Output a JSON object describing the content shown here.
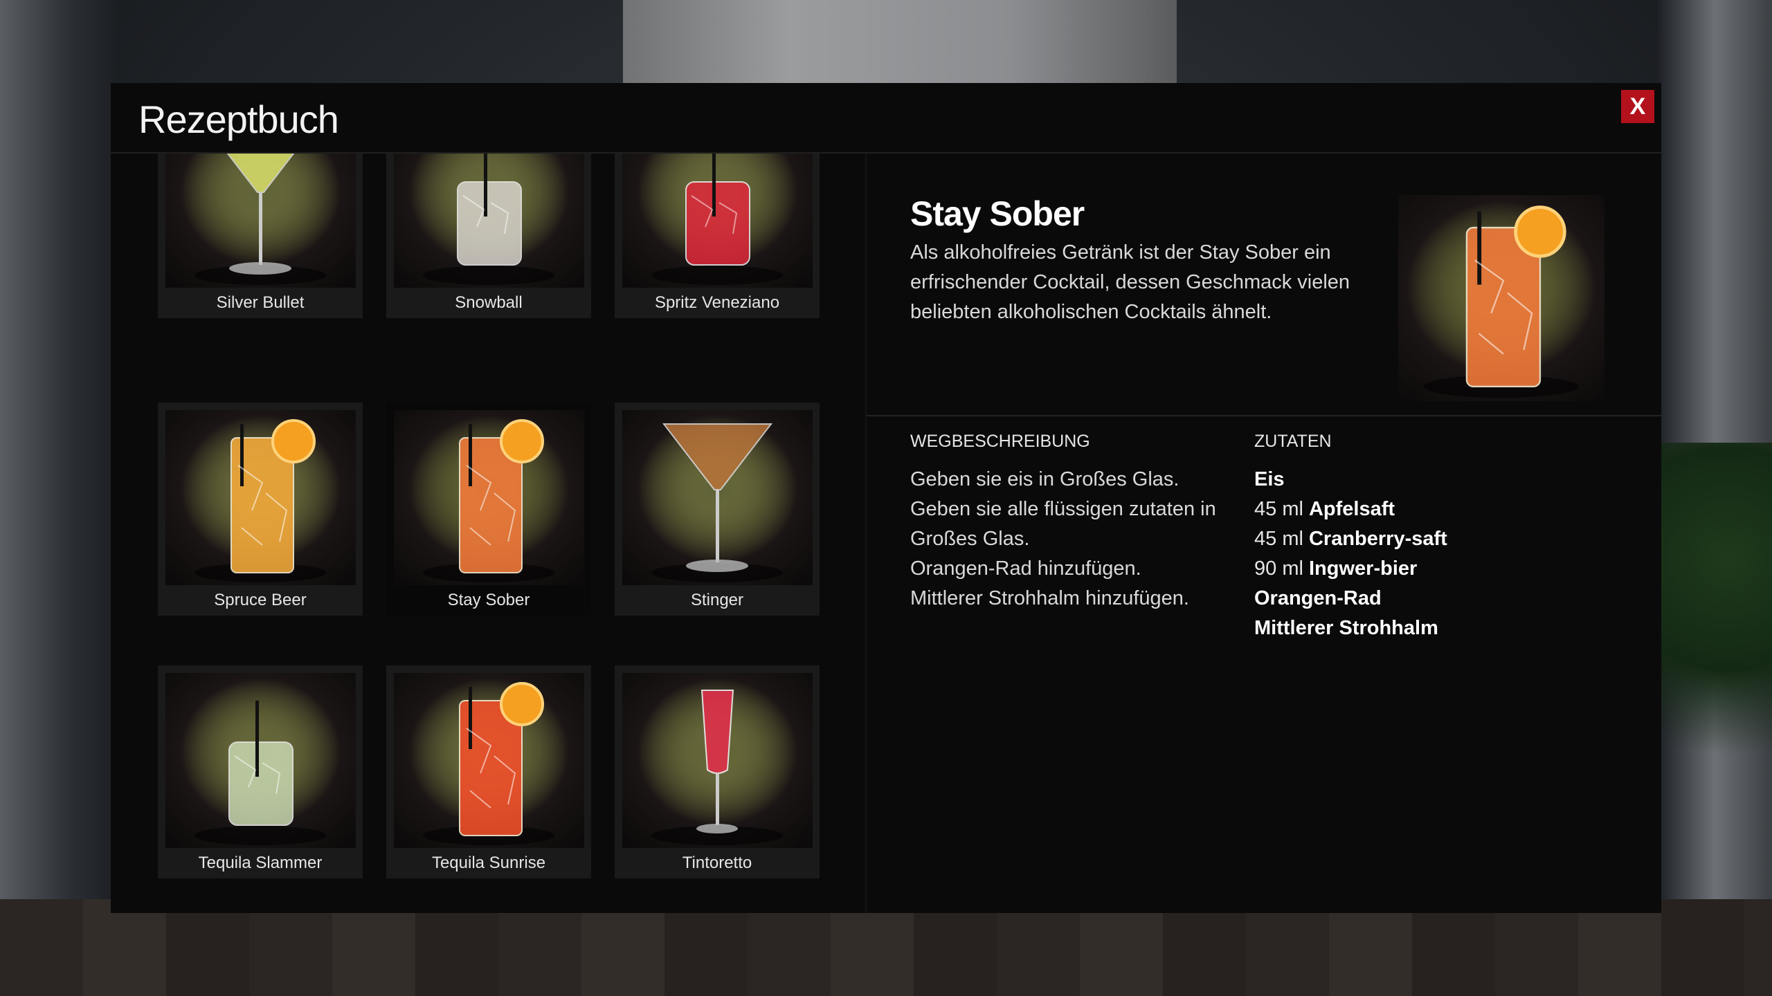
{
  "panel": {
    "title": "Rezeptbuch",
    "close_label": "X"
  },
  "recipes": [
    {
      "name": "Silver Bullet",
      "glass": "martini",
      "color": "#d9e06a"
    },
    {
      "name": "Snowball",
      "glass": "rocks",
      "color": "#d8d4cc"
    },
    {
      "name": "Spritz Veneziano",
      "glass": "rocks",
      "color": "#e0283a"
    },
    {
      "name": "Spruce Beer",
      "glass": "highball",
      "color": "#f0a83a"
    },
    {
      "name": "Stay Sober",
      "glass": "highball",
      "color": "#f07a3a",
      "selected": true
    },
    {
      "name": "Stinger",
      "glass": "martini",
      "color": "#b8743a"
    },
    {
      "name": "Tequila Slammer",
      "glass": "rocks",
      "color": "#c8d8b0"
    },
    {
      "name": "Tequila Sunrise",
      "glass": "highball",
      "color": "#f0502a"
    },
    {
      "name": "Tintoretto",
      "glass": "flute",
      "color": "#e0304a"
    }
  ],
  "detail": {
    "title": "Stay Sober",
    "description": "Als alkoholfreies Getränk ist der Stay Sober ein erfrischender Cocktail, dessen Geschmack vielen beliebten alkoholischen Cocktails ähnelt.",
    "directions_heading": "WEGBESCHREIBUNG",
    "ingredients_heading": "ZUTATEN",
    "steps": [
      "Geben sie eis in Großes Glas.",
      "Geben sie alle flüssigen zutaten in Großes Glas.",
      "Orangen-Rad hinzufügen.",
      "Mittlerer Strohhalm hinzufügen."
    ],
    "ingredients": [
      {
        "amount": "",
        "name": "Eis"
      },
      {
        "amount": "45 ml",
        "name": "Apfelsaft"
      },
      {
        "amount": "45 ml",
        "name": "Cranberry-saft"
      },
      {
        "amount": "90 ml",
        "name": "Ingwer-bier"
      },
      {
        "amount": "",
        "name": "Orangen-Rad"
      },
      {
        "amount": "",
        "name": "Mittlerer Strohhalm"
      }
    ]
  }
}
